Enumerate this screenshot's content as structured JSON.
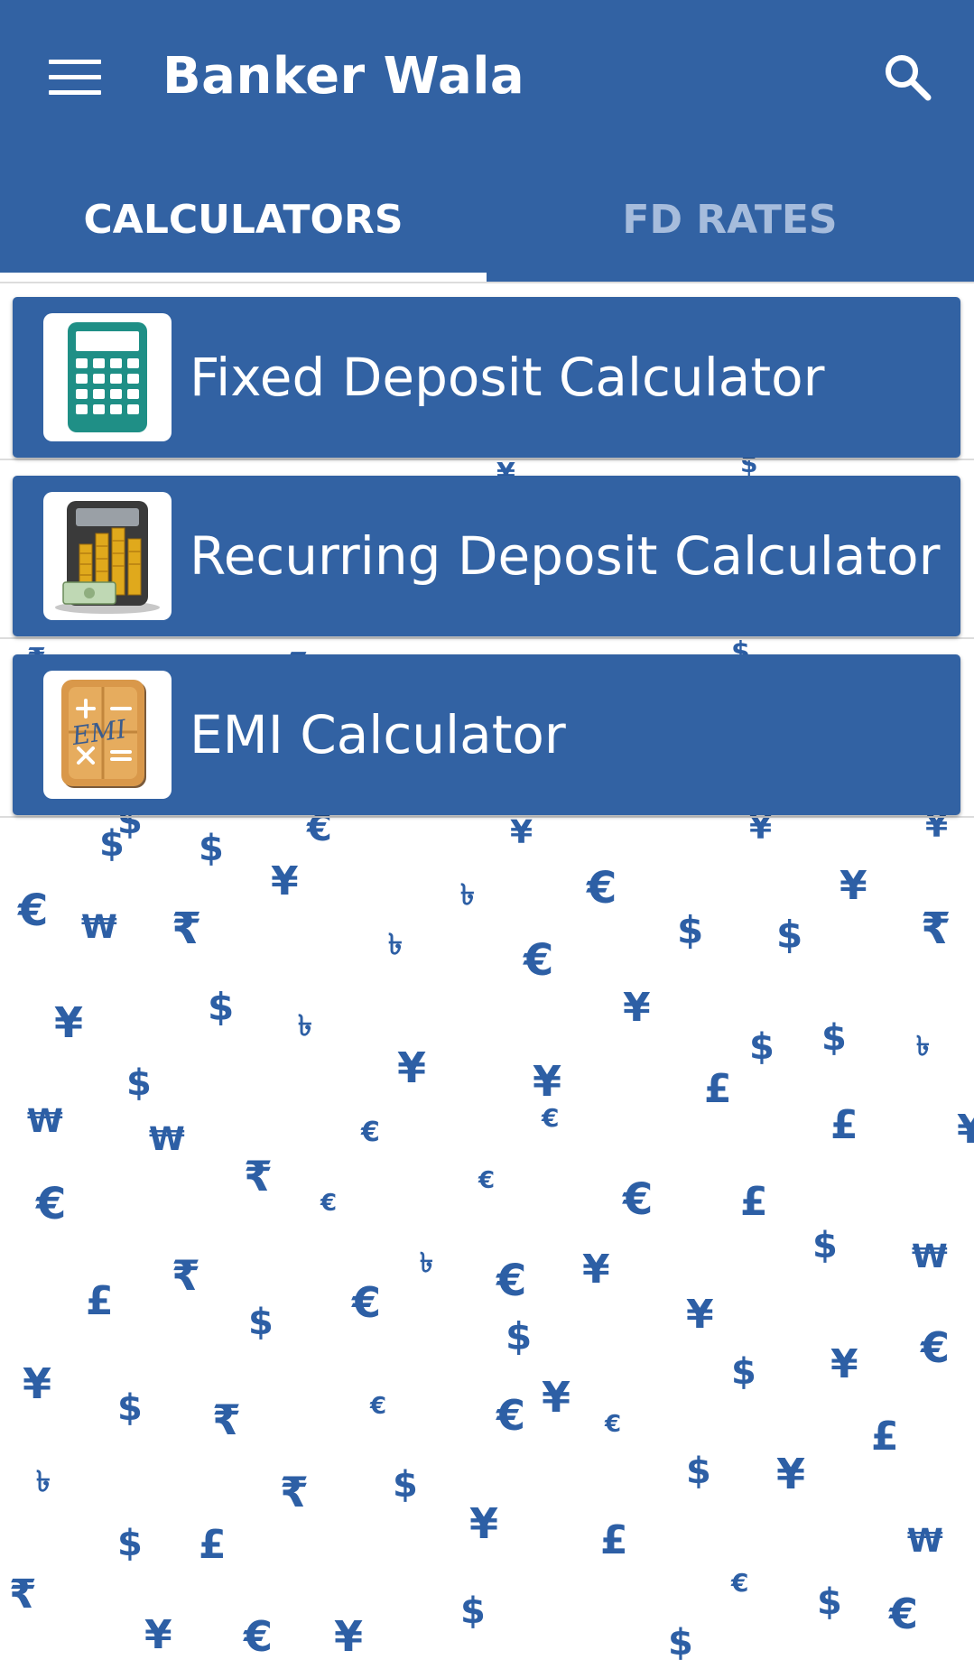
{
  "app_bar": {
    "title": "Banker Wala",
    "menu_icon": "hamburger-menu-icon",
    "search_icon": "search-icon",
    "background_color": "#3262a3"
  },
  "tabs": [
    {
      "label": "CALCULATORS",
      "selected": true
    },
    {
      "label": "FD RATES",
      "selected": false
    }
  ],
  "calculators": [
    {
      "label": "Fixed Deposit Calculator",
      "icon": "calculator-icon"
    },
    {
      "label": "Recurring Deposit Calculator",
      "icon": "coins-calculator-icon"
    },
    {
      "label": "EMI Calculator",
      "icon": "emi-calculator-icon",
      "icon_text": "EMI"
    }
  ],
  "background": {
    "pattern": "currency-symbols",
    "symbols": [
      "$",
      "€",
      "¥",
      "₹",
      "£",
      "₩",
      "৳"
    ],
    "symbol_color": "#2d5fa5"
  }
}
